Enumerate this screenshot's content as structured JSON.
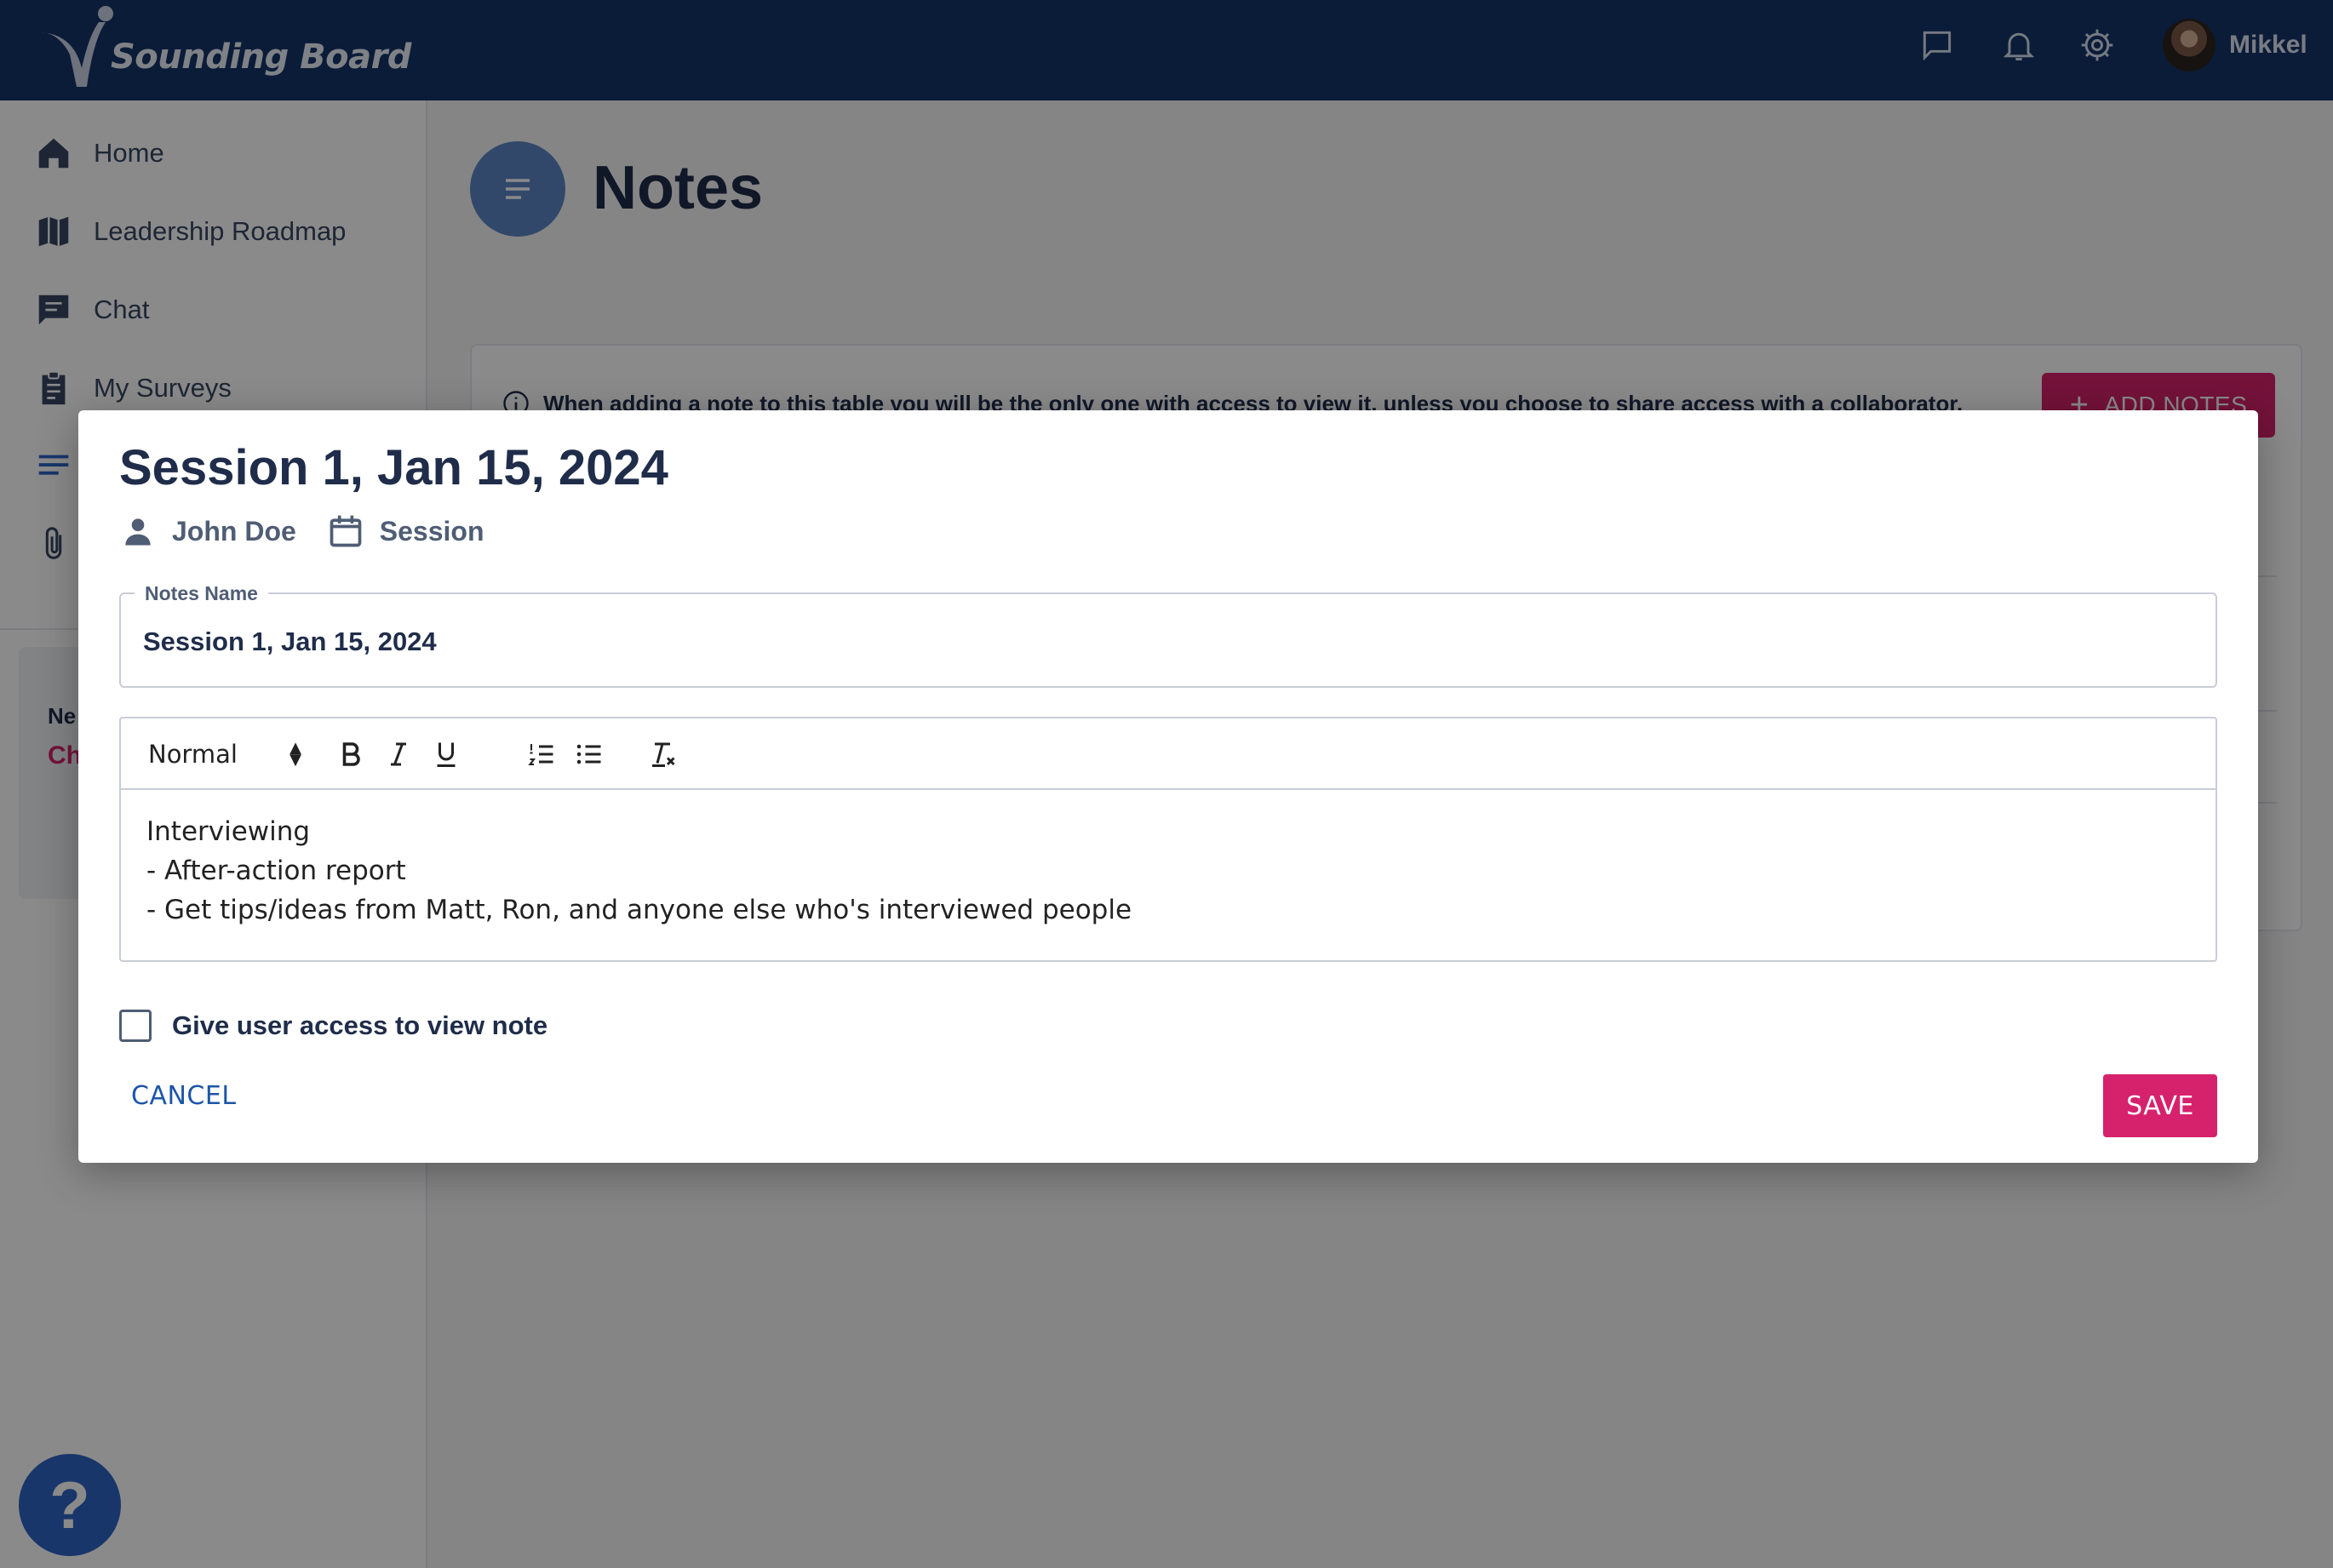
{
  "brand": {
    "name": "Sounding Board"
  },
  "header": {
    "icons": [
      "chat-bubble-icon",
      "bell-icon",
      "gear-icon"
    ],
    "user_name": "Mikkel"
  },
  "sidebar": {
    "items": [
      {
        "label": "Home",
        "icon": "home-icon"
      },
      {
        "label": "Leadership Roadmap",
        "icon": "map-icon"
      },
      {
        "label": "Chat",
        "icon": "chat-icon"
      },
      {
        "label": "My Surveys",
        "icon": "clipboard-icon"
      },
      {
        "label": "",
        "icon": "notes-icon"
      },
      {
        "label": "",
        "icon": "paperclip-icon"
      }
    ],
    "card": {
      "title": "Ne",
      "link": "Ch"
    }
  },
  "page": {
    "title": "Notes",
    "info_text": "When adding a note to this table you will be the only one with access to view it, unless you choose to share access with a collaborator.",
    "add_notes_label": "ADD NOTES"
  },
  "modal": {
    "title": "Session 1, Jan 15, 2024",
    "meta_person": "John Doe",
    "meta_type": "Session",
    "notes_name_label": "Notes Name",
    "notes_name_value": "Session 1, Jan 15, 2024",
    "editor": {
      "format": "Normal",
      "lines": [
        "Interviewing",
        "- After-action report",
        "- Get tips/ideas from Matt, Ron, and anyone else who's interviewed people"
      ]
    },
    "checkbox_label": "Give user access to view note",
    "cancel_label": "CANCEL",
    "save_label": "SAVE"
  },
  "help": {
    "label": "?"
  },
  "colors": {
    "header_bg": "#163469",
    "accent": "#d6226c",
    "link": "#1d55a8",
    "text_dark": "#1f2d4a"
  }
}
